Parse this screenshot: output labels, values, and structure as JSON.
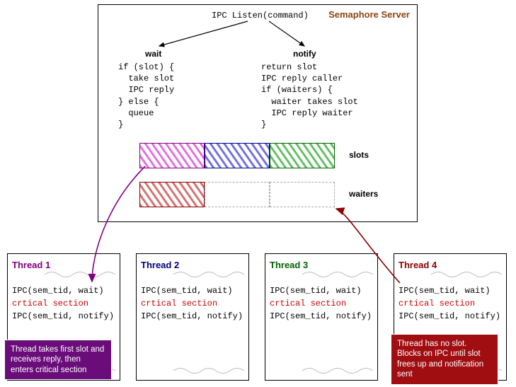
{
  "server": {
    "title": "Semaphore Server",
    "ipc_listen": "IPC Listen(command)",
    "wait": {
      "label": "wait",
      "code": "if (slot) {\n  take slot\n  IPC reply\n} else {\n  queue\n}"
    },
    "notify": {
      "label": "notify",
      "code": "return slot\nIPC reply caller\nif (waiters) {\n  waiter takes slot\n  IPC reply waiter\n}"
    },
    "slots_label": "slots",
    "waiters_label": "waiters"
  },
  "threads": [
    {
      "title": "Thread 1",
      "wait_call": "IPC(sem_tid, wait)",
      "crit": "crtical section",
      "notify_call": "IPC(sem_tid, notify)"
    },
    {
      "title": "Thread 2",
      "wait_call": "IPC(sem_tid, wait)",
      "crit": "crtical section",
      "notify_call": "IPC(sem_tid, notify)"
    },
    {
      "title": "Thread 3",
      "wait_call": "IPC(sem_tid, wait)",
      "crit": "crtical section",
      "notify_call": "IPC(sem_tid, notify)"
    },
    {
      "title": "Thread 4",
      "wait_call": "IPC(sem_tid, wait)",
      "crit": "crtical section",
      "notify_call": "IPC(sem_tid, notify)"
    }
  ],
  "callouts": {
    "thread1": "Thread takes first slot and receives reply, then enters critical section",
    "thread4": "Thread has no slot. Blocks on IPC until slot frees up and notification sent"
  }
}
